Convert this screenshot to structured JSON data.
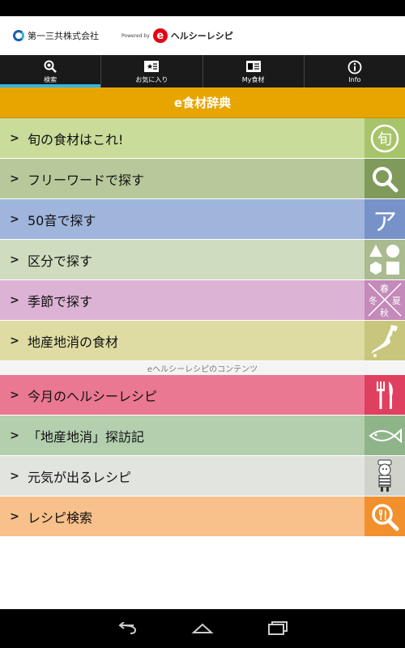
{
  "header": {
    "company": "第一三共株式会社",
    "powered_by": "Powered by",
    "brand_mark": "e",
    "brand": "ヘルシーレシピ"
  },
  "tabs": [
    {
      "label": "検索",
      "icon": "search-icon"
    },
    {
      "label": "お気に入り",
      "icon": "favorite-icon"
    },
    {
      "label": "My食材",
      "icon": "my-ingredient-icon"
    },
    {
      "label": "Info",
      "icon": "info-icon"
    }
  ],
  "banner": {
    "title": "e食材辞典"
  },
  "menu1": [
    {
      "label": "旬の食材はこれ!",
      "color": "#c9dc9a",
      "tile": "#a8c46a",
      "tile_text": "旬"
    },
    {
      "label": "フリーワードで探す",
      "color": "#b7c99a",
      "tile": "#7f9a5a"
    },
    {
      "label": "50音で探す",
      "color": "#9fb5dc",
      "tile": "#7792c8",
      "tile_text": "ア"
    },
    {
      "label": "区分で探す",
      "color": "#cfdcbf",
      "tile": "#a9bb8f"
    },
    {
      "label": "季節で探す",
      "color": "#dcb3d4",
      "tile": "#c48ab9",
      "season": [
        "春",
        "夏",
        "冬",
        "秋"
      ]
    },
    {
      "label": "地産地消の食材",
      "color": "#dedca3",
      "tile": "#c8c67c"
    }
  ],
  "divider": "eヘルシーレシピのコンテンツ",
  "menu2": [
    {
      "label": "今月のヘルシーレシピ",
      "color": "#ea7892",
      "tile": "#e0405f"
    },
    {
      "label": "「地産地消」探訪記",
      "color": "#b3cfae",
      "tile": "#8fb48a"
    },
    {
      "label": "元気が出るレシピ",
      "color": "#e2e4df",
      "tile": "#d0d2cc"
    },
    {
      "label": "レシピ検索",
      "color": "#f8c08a",
      "tile": "#f1902c"
    }
  ]
}
